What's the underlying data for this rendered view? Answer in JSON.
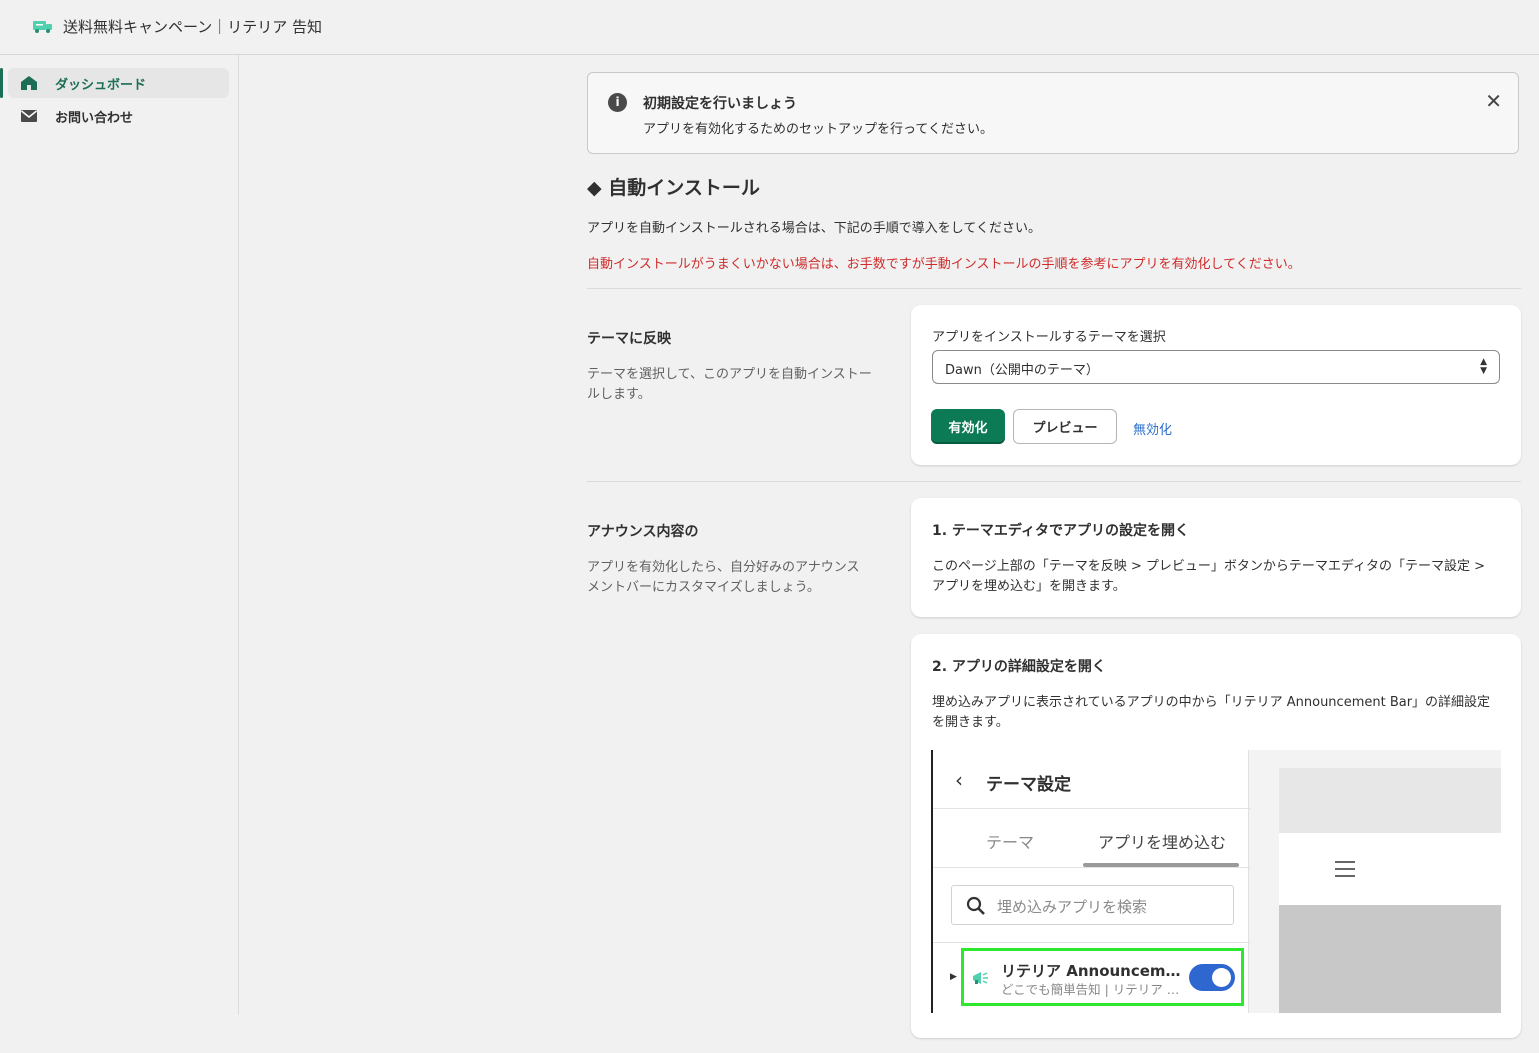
{
  "app": {
    "title": "送料無料キャンペーン｜リテリア 告知",
    "icon": "truck-icon",
    "accent": "#1b6e55"
  },
  "sidebar": {
    "items": [
      {
        "label": "ダッシュボード",
        "icon": "home-icon",
        "active": true
      },
      {
        "label": "お問い合わせ",
        "icon": "mail-icon",
        "active": false
      }
    ]
  },
  "banner": {
    "title": "初期設定を行いましょう",
    "text": "アプリを有効化するためのセットアップを行ってください。",
    "info_glyph": "i",
    "close_glyph": "✕"
  },
  "auto_install": {
    "title": "◆ 自動インストール",
    "description": "アプリを自動インストールされる場合は、下記の手順で導入をしてください。",
    "warning": "自動インストールがうまくいかない場合は、お手数ですが手動インストールの手順を参考にアプリを有効化してください。"
  },
  "theme_section": {
    "heading": "テーマに反映",
    "text": "テーマを選択して、このアプリを自動インストールします。",
    "select_label": "アプリをインストールするテーマを選択",
    "select_value": "Dawn（公開中のテーマ）",
    "activate_label": "有効化",
    "preview_label": "プレビュー",
    "deactivate_label": "無効化"
  },
  "announce_section": {
    "heading": "アナウンス内容の",
    "text": "アプリを有効化したら、自分好みのアナウンスメントバーにカスタマイズしましょう。",
    "step1": {
      "title": "1. テーマエディタでアプリの設定を開く",
      "text": "このページ上部の「テーマを反映 > プレビュー」ボタンからテーマエディタの「テーマ設定 > アプリを埋め込む」を開きます。"
    },
    "step2": {
      "title": "2. アプリの詳細設定を開く",
      "text": "埋め込みアプリに表示されているアプリの中から「リテリア Announcement Bar」の詳細設定を開きます。"
    }
  },
  "screenshot": {
    "back_glyph": "‹",
    "title": "テーマ設定",
    "tabs": [
      "テーマ",
      "アプリを埋め込む"
    ],
    "search_placeholder": "埋め込みアプリを検索",
    "app_name": "リテリア Announcement Bar",
    "app_sub": "どこでも簡単告知 | リテリア Announcement Bar",
    "toggle_on": true,
    "highlight_color": "#2de82d"
  }
}
